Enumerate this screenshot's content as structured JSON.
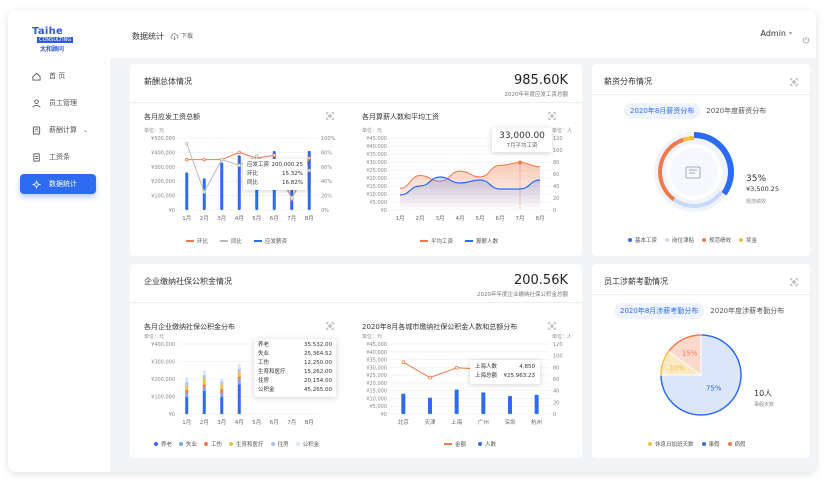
{
  "brand": {
    "en": "Taihe",
    "sub": "CONSULTING",
    "cn": "太和顾问"
  },
  "nav": [
    {
      "label": "首 页",
      "icon": "home-icon"
    },
    {
      "label": "员工管理",
      "icon": "user-icon"
    },
    {
      "label": "薪酬计算",
      "icon": "calculator-icon"
    },
    {
      "label": "工资条",
      "icon": "document-icon"
    },
    {
      "label": "数据统计",
      "icon": "statistics-icon"
    }
  ],
  "topbar": {
    "title": "数据统计",
    "download": "下载",
    "user": "Admin"
  },
  "salary": {
    "title": "薪酬总体情况",
    "total": "985.60K",
    "total_label": "2020年年度应发工资总额",
    "c1": {
      "title": "各月应发工资总额",
      "unit": "单位：元",
      "tip": {
        "r1k": "应发工资",
        "r1v": "200,000.25",
        "r2k": "环比",
        "r2v": "15.32%",
        "r3k": "同比",
        "r3v": "16.82%"
      },
      "legend": [
        "环比",
        "同比",
        "应发薪资"
      ]
    },
    "c2": {
      "title": "各月算薪人数和平均工资",
      "unit": "单位：元",
      "unit2": "单位：人",
      "tip_value": "33,000.00",
      "tip_label": "7月平均工资",
      "legend": [
        "平均工资",
        "算薪人数"
      ]
    }
  },
  "social": {
    "title": "企业缴纳社保公积金情况",
    "total": "200.56K",
    "total_label": "2020年年度企业缴纳社保公积金总额",
    "c1": {
      "title": "各月企业缴纳社保公积金分布",
      "unit": "单位：元",
      "tip": [
        {
          "k": "养老",
          "v": "35,532.00"
        },
        {
          "k": "失业",
          "v": "25,364.52"
        },
        {
          "k": "工伤",
          "v": "12,250.00"
        },
        {
          "k": "生育和医疗",
          "v": "15,262.00"
        },
        {
          "k": "住房",
          "v": "20,154.00"
        },
        {
          "k": "公积金",
          "v": "45,265.00"
        }
      ],
      "legend": [
        "养老",
        "失业",
        "工伤",
        "生育和医疗",
        "住房",
        "公积金"
      ]
    },
    "c2": {
      "title": "2020年8月各城市缴纳社保公积金人数和总额分布",
      "unit": "单位：元",
      "unit2": "单位：人",
      "tip": {
        "r1k": "上海人数",
        "r1v": "4,850",
        "r2k": "上海总额",
        "r2v": "¥25,963.23"
      },
      "legend": [
        "金额",
        "人数"
      ]
    }
  },
  "dist": {
    "title": "薪资分布情况",
    "tabs": [
      "2020年8月薪资分布",
      "2020年度薪资分布"
    ],
    "pct": "35%",
    "amt": "¥3,500.25",
    "sub": "规范绩效",
    "legend": [
      "基本工资",
      "岗位津贴",
      "规范绩效",
      "奖金"
    ]
  },
  "attend": {
    "title": "员工涉薪考勤情况",
    "tabs": [
      "2020年8月涉薪考勤分布",
      "2020年度涉薪考勤分布"
    ],
    "p1": "15%",
    "p2": "10%",
    "p3": "75%",
    "count": "10人",
    "count_sub": "事假天数",
    "legend": [
      "休息日加班天数",
      "事假",
      "病假"
    ]
  },
  "colors": {
    "primary": "#2d6cf0",
    "orange": "#f07a4a",
    "yellow": "#f5c042",
    "light": "#c9d9f8"
  },
  "chart_data": [
    {
      "type": "bar",
      "title": "各月应发工资总额",
      "categories": [
        "1月",
        "2月",
        "3月",
        "4月",
        "5月",
        "6月",
        "7月",
        "8月"
      ],
      "ylabel": "单位：元",
      "ylim": [
        0,
        500000
      ],
      "y2lim": [
        0,
        100
      ],
      "yticks": [
        "¥0",
        "¥100,000",
        "¥200,000",
        "¥300,000",
        "¥400,000",
        "¥500,000"
      ],
      "y2ticks": [
        "0%",
        "20%",
        "40%",
        "60%",
        "80%",
        "100%"
      ],
      "series": [
        {
          "name": "应发薪资",
          "values": [
            260000,
            220000,
            330000,
            380000,
            360000,
            410000,
            200000,
            410000
          ]
        },
        {
          "name": "环比",
          "values": [
            70,
            70,
            70,
            80,
            72,
            76,
            15,
            72
          ]
        },
        {
          "name": "同比",
          "values": [
            92,
            25,
            70,
            62,
            75,
            55,
            17,
            55
          ]
        }
      ]
    },
    {
      "type": "area",
      "title": "各月算薪人数和平均工资",
      "categories": [
        "1月",
        "2月",
        "3月",
        "4月",
        "5月",
        "6月",
        "7月",
        "8月"
      ],
      "ylim": [
        0,
        50000
      ],
      "y2lim": [
        0,
        120
      ],
      "yticks": [
        "¥0",
        "¥5,000",
        "¥10,000",
        "¥15,000",
        "¥20,000",
        "¥25,000",
        "¥30,000",
        "¥35,000",
        "¥40,000",
        "¥45,000"
      ],
      "y2ticks": [
        "0",
        "20",
        "40",
        "60",
        "80",
        "100",
        "120"
      ],
      "series": [
        {
          "name": "平均工资",
          "values": [
            15000,
            24000,
            20000,
            27000,
            23000,
            31000,
            33000,
            30000
          ]
        },
        {
          "name": "算薪人数",
          "values": [
            25,
            40,
            55,
            45,
            50,
            35,
            35,
            50
          ]
        }
      ]
    },
    {
      "type": "bar",
      "title": "各月企业缴纳社保公积金分布",
      "categories": [
        "1月",
        "2月",
        "3月",
        "4月",
        "5月",
        "6月",
        "7月",
        "8月"
      ],
      "ylim": [
        0,
        450000
      ],
      "yticks": [
        "¥0",
        "¥100,000",
        "¥200,000",
        "¥300,000",
        "¥400,000"
      ],
      "series": [
        {
          "name": "养老",
          "values": [
            110000,
            150000,
            110000,
            190000,
            0,
            0,
            0,
            0
          ]
        },
        {
          "name": "失业",
          "values": [
            25000,
            20000,
            25000,
            30000,
            0,
            0,
            0,
            0
          ]
        },
        {
          "name": "工伤",
          "values": [
            20000,
            20000,
            25000,
            20000,
            0,
            0,
            0,
            0
          ]
        },
        {
          "name": "生育和医疗",
          "values": [
            30000,
            40000,
            30000,
            30000,
            0,
            0,
            0,
            0
          ]
        },
        {
          "name": "住房",
          "values": [
            20000,
            20000,
            20000,
            20000,
            0,
            0,
            0,
            0
          ]
        },
        {
          "name": "公积金",
          "values": [
            30000,
            30000,
            20000,
            30000,
            0,
            0,
            0,
            0
          ]
        }
      ]
    },
    {
      "type": "bar",
      "title": "2020年8月各城市缴纳社保公积金人数和总额分布",
      "categories": [
        "北京",
        "天津",
        "上海",
        "广州",
        "深圳",
        "杭州"
      ],
      "ylim": [
        0,
        50000
      ],
      "y2lim": [
        0,
        120
      ],
      "yticks": [
        "¥0",
        "¥5,000",
        "¥10,000",
        "¥15,000",
        "¥20,000",
        "¥25,000",
        "¥30,000",
        "¥35,000",
        "¥40,000",
        "¥45,000"
      ],
      "y2ticks": [
        "0",
        "20",
        "40",
        "60",
        "80",
        "100",
        "120"
      ],
      "series": [
        {
          "name": "人数",
          "values": [
            35,
            28,
            42,
            37,
            31,
            33
          ]
        },
        {
          "name": "金额",
          "values": [
            37000,
            26000,
            33000,
            32000,
            28000,
            35000
          ]
        }
      ]
    },
    {
      "type": "pie",
      "title": "薪资分布情况",
      "categories": [
        "基本工资",
        "岗位津贴",
        "规范绩效",
        "奖金"
      ],
      "values": [
        35,
        25,
        35,
        5
      ]
    },
    {
      "type": "pie",
      "title": "员工涉薪考勤情况",
      "categories": [
        "事假",
        "休息日加班天数",
        "病假"
      ],
      "values": [
        75,
        10,
        15
      ]
    }
  ]
}
